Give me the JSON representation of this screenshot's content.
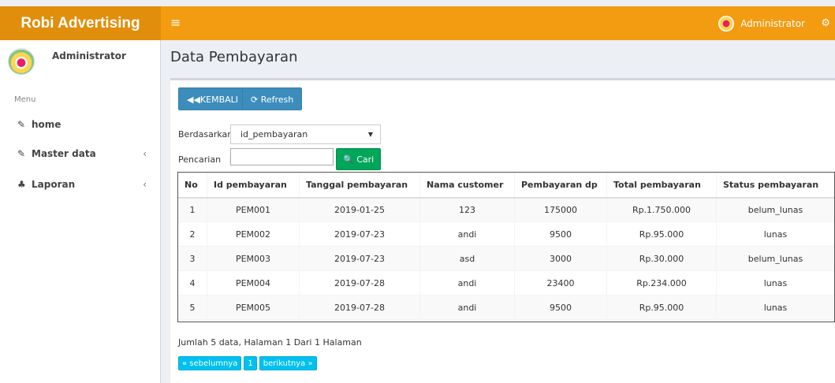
{
  "header": {
    "brand": "Robi Advertising",
    "menu_icon": "hamburger-icon",
    "user_name": "Administrator",
    "settings_icon": "gears-icon"
  },
  "sidebar": {
    "user_name": "Administrator",
    "menu_header": "Menu",
    "items": [
      {
        "label": "home",
        "icon": "edit-icon",
        "icon_glyph": "✎"
      },
      {
        "label": "Master data",
        "icon": "edit-icon",
        "icon_glyph": "✎",
        "chevron": "‹"
      },
      {
        "label": "Laporan",
        "icon": "sitemap-icon",
        "icon_glyph": "♣",
        "chevron": "‹"
      }
    ]
  },
  "page": {
    "title": "Data Pembayaran"
  },
  "toolbar": {
    "back_label": "◀◀KEMBALI",
    "refresh_label": "⟳ Refresh"
  },
  "filter": {
    "by_label": "Berdasarkan:",
    "by_value": "id_pembayaran",
    "search_label": "Pencarian   :",
    "search_value": "",
    "search_button": "🔍 Cari"
  },
  "table": {
    "headers": [
      "No",
      "Id pembayaran",
      "Tanggal pembayaran",
      "Nama customer",
      "Pembayaran dp",
      "Total pembayaran",
      "Status pembayaran"
    ],
    "rows": [
      [
        "1",
        "PEM001",
        "2019-01-25",
        "123",
        "175000",
        "Rp.1.750.000",
        "belum_lunas"
      ],
      [
        "2",
        "PEM002",
        "2019-07-23",
        "andi",
        "9500",
        "Rp.95.000",
        "lunas"
      ],
      [
        "3",
        "PEM003",
        "2019-07-23",
        "asd",
        "3000",
        "Rp.30.000",
        "belum_lunas"
      ],
      [
        "4",
        "PEM004",
        "2019-07-28",
        "andi",
        "23400",
        "Rp.234.000",
        "lunas"
      ],
      [
        "5",
        "PEM005",
        "2019-07-28",
        "andi",
        "9500",
        "Rp.95.000",
        "lunas"
      ]
    ]
  },
  "footer": {
    "summary": "Jumlah 5 data, Halaman 1 Dari 1 Halaman",
    "prev_label": "« sebelumnya",
    "page_label": "1",
    "next_label": "berikutnya »"
  },
  "colors": {
    "header": "#f39c12",
    "primary": "#3c8dbc",
    "success": "#00a65a",
    "info": "#00c0ef"
  }
}
